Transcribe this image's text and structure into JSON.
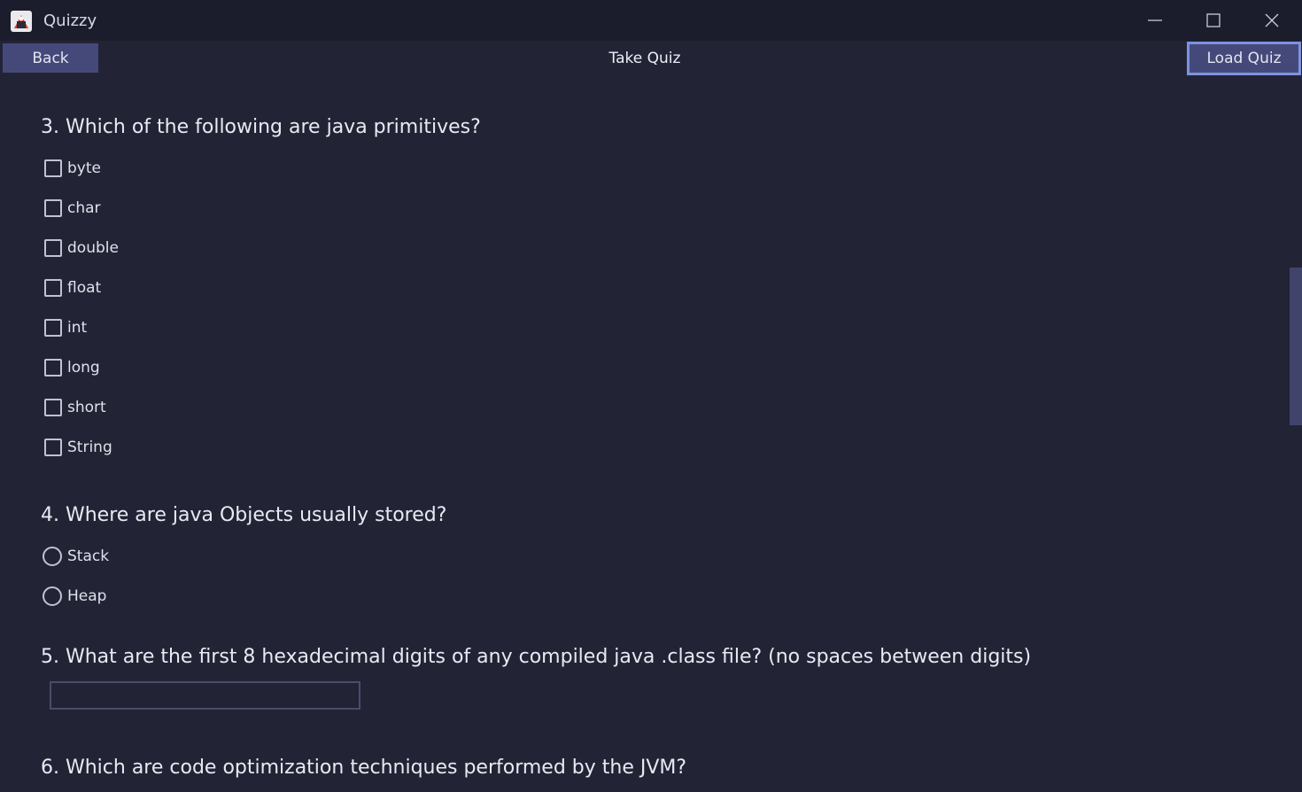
{
  "window": {
    "title": "Quizzy",
    "icons": {
      "app": "app-logo-icon",
      "minimize": "minimize-icon",
      "maximize": "maximize-icon",
      "close": "close-icon"
    }
  },
  "toolbar": {
    "back_label": "Back",
    "title": "Take Quiz",
    "load_label": "Load Quiz"
  },
  "questions": [
    {
      "title": "3. Which of the following are java primitives?",
      "type": "checkbox",
      "options": [
        "byte",
        "char",
        "double",
        "float",
        "int",
        "long",
        "short",
        "String"
      ]
    },
    {
      "title": "4. Where are java Objects usually stored?",
      "type": "radio",
      "options": [
        "Stack",
        "Heap"
      ]
    },
    {
      "title": "5. What are the first 8 hexadecimal digits of any compiled java .class file? (no spaces between digits)",
      "type": "text",
      "value": ""
    },
    {
      "title": "6. Which are code optimization techniques performed by the JVM?",
      "type": "checkbox",
      "options": []
    }
  ],
  "colors": {
    "background": "#222436",
    "titlebar": "#1b1c2c",
    "button": "#45497a",
    "focus_border": "#7c93de",
    "scrollbar_thumb": "#40436a"
  }
}
